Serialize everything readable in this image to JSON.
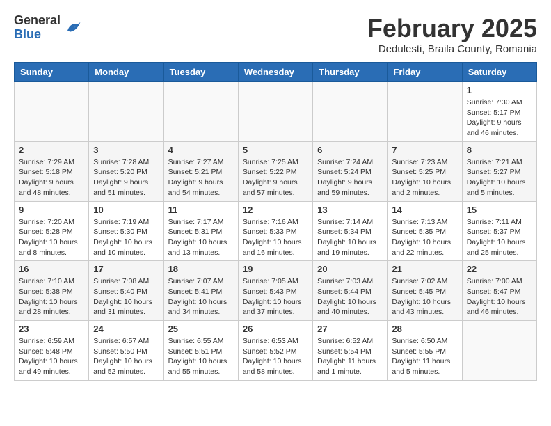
{
  "header": {
    "logo": {
      "general": "General",
      "blue": "Blue"
    },
    "month_title": "February 2025",
    "subtitle": "Dedulesti, Braila County, Romania"
  },
  "weekdays": [
    "Sunday",
    "Monday",
    "Tuesday",
    "Wednesday",
    "Thursday",
    "Friday",
    "Saturday"
  ],
  "weeks": [
    [
      {
        "day": "",
        "info": ""
      },
      {
        "day": "",
        "info": ""
      },
      {
        "day": "",
        "info": ""
      },
      {
        "day": "",
        "info": ""
      },
      {
        "day": "",
        "info": ""
      },
      {
        "day": "",
        "info": ""
      },
      {
        "day": "1",
        "info": "Sunrise: 7:30 AM\nSunset: 5:17 PM\nDaylight: 9 hours\nand 46 minutes."
      }
    ],
    [
      {
        "day": "2",
        "info": "Sunrise: 7:29 AM\nSunset: 5:18 PM\nDaylight: 9 hours\nand 48 minutes."
      },
      {
        "day": "3",
        "info": "Sunrise: 7:28 AM\nSunset: 5:20 PM\nDaylight: 9 hours\nand 51 minutes."
      },
      {
        "day": "4",
        "info": "Sunrise: 7:27 AM\nSunset: 5:21 PM\nDaylight: 9 hours\nand 54 minutes."
      },
      {
        "day": "5",
        "info": "Sunrise: 7:25 AM\nSunset: 5:22 PM\nDaylight: 9 hours\nand 57 minutes."
      },
      {
        "day": "6",
        "info": "Sunrise: 7:24 AM\nSunset: 5:24 PM\nDaylight: 9 hours\nand 59 minutes."
      },
      {
        "day": "7",
        "info": "Sunrise: 7:23 AM\nSunset: 5:25 PM\nDaylight: 10 hours\nand 2 minutes."
      },
      {
        "day": "8",
        "info": "Sunrise: 7:21 AM\nSunset: 5:27 PM\nDaylight: 10 hours\nand 5 minutes."
      }
    ],
    [
      {
        "day": "9",
        "info": "Sunrise: 7:20 AM\nSunset: 5:28 PM\nDaylight: 10 hours\nand 8 minutes."
      },
      {
        "day": "10",
        "info": "Sunrise: 7:19 AM\nSunset: 5:30 PM\nDaylight: 10 hours\nand 10 minutes."
      },
      {
        "day": "11",
        "info": "Sunrise: 7:17 AM\nSunset: 5:31 PM\nDaylight: 10 hours\nand 13 minutes."
      },
      {
        "day": "12",
        "info": "Sunrise: 7:16 AM\nSunset: 5:33 PM\nDaylight: 10 hours\nand 16 minutes."
      },
      {
        "day": "13",
        "info": "Sunrise: 7:14 AM\nSunset: 5:34 PM\nDaylight: 10 hours\nand 19 minutes."
      },
      {
        "day": "14",
        "info": "Sunrise: 7:13 AM\nSunset: 5:35 PM\nDaylight: 10 hours\nand 22 minutes."
      },
      {
        "day": "15",
        "info": "Sunrise: 7:11 AM\nSunset: 5:37 PM\nDaylight: 10 hours\nand 25 minutes."
      }
    ],
    [
      {
        "day": "16",
        "info": "Sunrise: 7:10 AM\nSunset: 5:38 PM\nDaylight: 10 hours\nand 28 minutes."
      },
      {
        "day": "17",
        "info": "Sunrise: 7:08 AM\nSunset: 5:40 PM\nDaylight: 10 hours\nand 31 minutes."
      },
      {
        "day": "18",
        "info": "Sunrise: 7:07 AM\nSunset: 5:41 PM\nDaylight: 10 hours\nand 34 minutes."
      },
      {
        "day": "19",
        "info": "Sunrise: 7:05 AM\nSunset: 5:43 PM\nDaylight: 10 hours\nand 37 minutes."
      },
      {
        "day": "20",
        "info": "Sunrise: 7:03 AM\nSunset: 5:44 PM\nDaylight: 10 hours\nand 40 minutes."
      },
      {
        "day": "21",
        "info": "Sunrise: 7:02 AM\nSunset: 5:45 PM\nDaylight: 10 hours\nand 43 minutes."
      },
      {
        "day": "22",
        "info": "Sunrise: 7:00 AM\nSunset: 5:47 PM\nDaylight: 10 hours\nand 46 minutes."
      }
    ],
    [
      {
        "day": "23",
        "info": "Sunrise: 6:59 AM\nSunset: 5:48 PM\nDaylight: 10 hours\nand 49 minutes."
      },
      {
        "day": "24",
        "info": "Sunrise: 6:57 AM\nSunset: 5:50 PM\nDaylight: 10 hours\nand 52 minutes."
      },
      {
        "day": "25",
        "info": "Sunrise: 6:55 AM\nSunset: 5:51 PM\nDaylight: 10 hours\nand 55 minutes."
      },
      {
        "day": "26",
        "info": "Sunrise: 6:53 AM\nSunset: 5:52 PM\nDaylight: 10 hours\nand 58 minutes."
      },
      {
        "day": "27",
        "info": "Sunrise: 6:52 AM\nSunset: 5:54 PM\nDaylight: 11 hours\nand 1 minute."
      },
      {
        "day": "28",
        "info": "Sunrise: 6:50 AM\nSunset: 5:55 PM\nDaylight: 11 hours\nand 5 minutes."
      },
      {
        "day": "",
        "info": ""
      }
    ]
  ]
}
